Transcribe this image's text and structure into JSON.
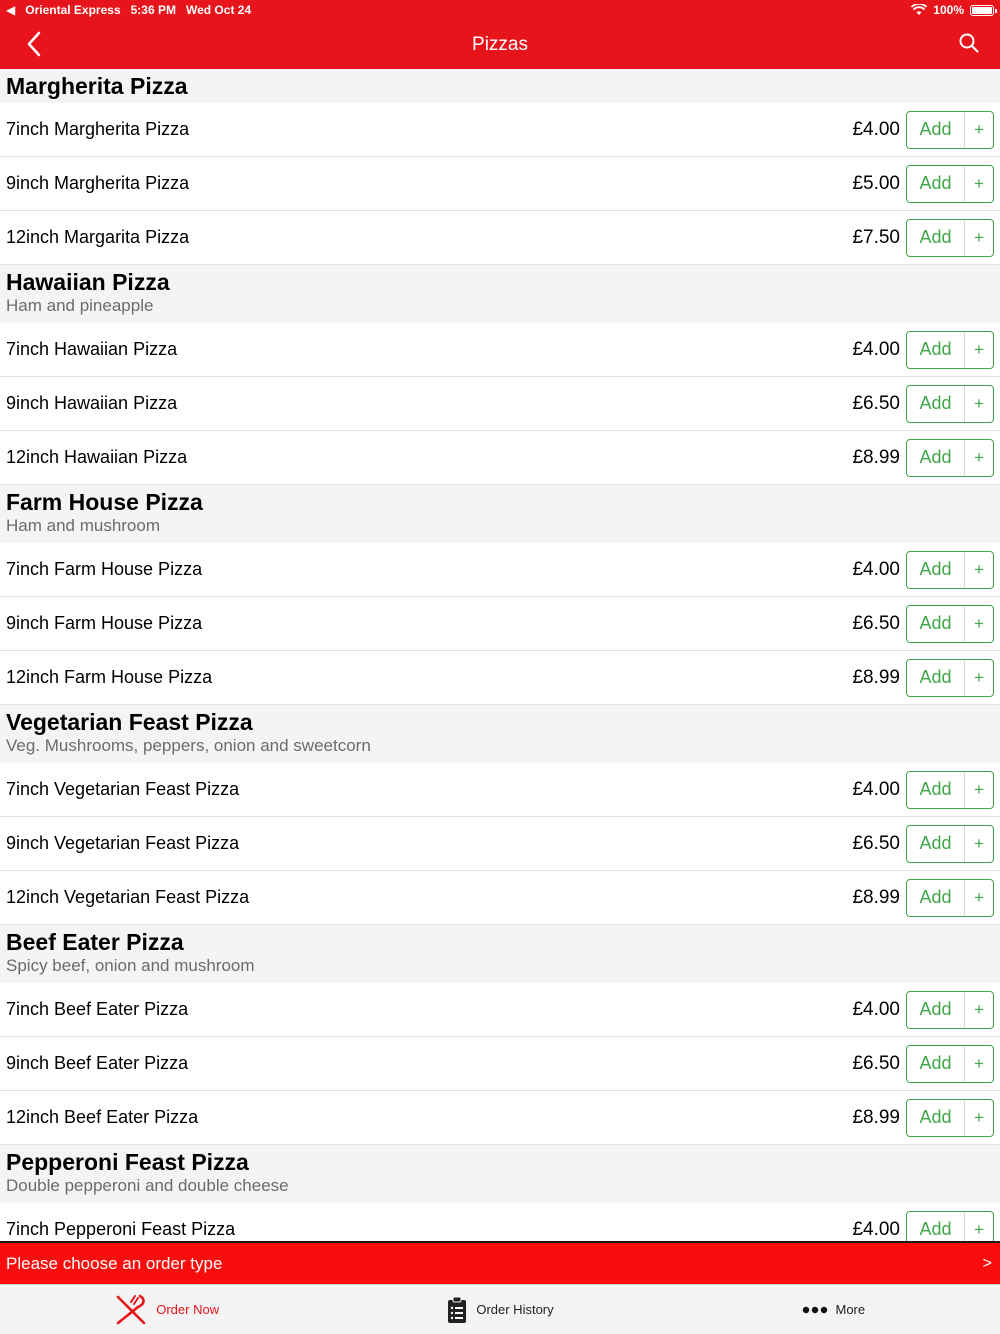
{
  "status": {
    "carrier": "Oriental Express",
    "time": "5:36 PM",
    "date": "Wed Oct 24",
    "battery": "100%"
  },
  "nav": {
    "title": "Pizzas"
  },
  "sections": [
    {
      "title": "Margherita Pizza",
      "desc": "",
      "items": [
        {
          "name": "7inch Margherita Pizza",
          "price": "£4.00"
        },
        {
          "name": "9inch Margherita Pizza",
          "price": "£5.00"
        },
        {
          "name": "12inch Margarita Pizza",
          "price": "£7.50"
        }
      ]
    },
    {
      "title": "Hawaiian Pizza",
      "desc": "Ham and pineapple",
      "items": [
        {
          "name": "7inch Hawaiian Pizza",
          "price": "£4.00"
        },
        {
          "name": "9inch Hawaiian Pizza",
          "price": "£6.50"
        },
        {
          "name": "12inch Hawaiian Pizza",
          "price": "£8.99"
        }
      ]
    },
    {
      "title": "Farm House Pizza",
      "desc": "Ham and mushroom",
      "items": [
        {
          "name": "7inch Farm House Pizza",
          "price": "£4.00"
        },
        {
          "name": "9inch Farm House Pizza",
          "price": "£6.50"
        },
        {
          "name": "12inch Farm House Pizza",
          "price": "£8.99"
        }
      ]
    },
    {
      "title": "Vegetarian Feast Pizza",
      "desc": "Veg. Mushrooms, peppers, onion and sweetcorn",
      "items": [
        {
          "name": "7inch Vegetarian Feast Pizza",
          "price": "£4.00"
        },
        {
          "name": "9inch Vegetarian Feast Pizza",
          "price": "£6.50"
        },
        {
          "name": "12inch Vegetarian Feast Pizza",
          "price": "£8.99"
        }
      ]
    },
    {
      "title": "Beef Eater Pizza",
      "desc": "Spicy beef, onion and mushroom",
      "items": [
        {
          "name": "7inch Beef Eater Pizza",
          "price": "£4.00"
        },
        {
          "name": "9inch Beef Eater Pizza",
          "price": "£6.50"
        },
        {
          "name": "12inch Beef Eater Pizza",
          "price": "£8.99"
        }
      ]
    },
    {
      "title": "Pepperoni Feast Pizza",
      "desc": "Double pepperoni and double cheese",
      "items": [
        {
          "name": "7inch Pepperoni Feast Pizza",
          "price": "£4.00"
        }
      ]
    }
  ],
  "add_label": "Add",
  "plus_label": "+",
  "order_bar": {
    "message": "Please choose an order type",
    "arrow": ">"
  },
  "tabs": [
    {
      "label": "Order Now",
      "icon": "fork-knife-icon",
      "active": true
    },
    {
      "label": "Order History",
      "icon": "clipboard-icon",
      "active": false
    },
    {
      "label": "More",
      "icon": "more-dots-icon",
      "active": false
    }
  ],
  "colors": {
    "brand": "#e8141b",
    "accent_green": "#3fa649"
  }
}
